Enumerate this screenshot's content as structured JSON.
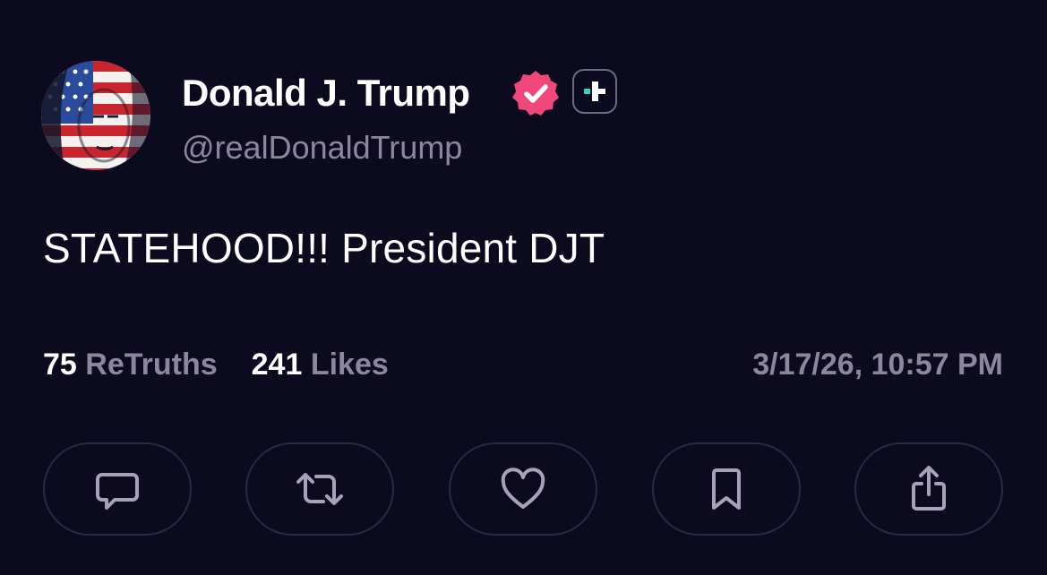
{
  "post": {
    "author": {
      "display_name": "Donald J. Trump",
      "handle": "@realDonaldTrump",
      "avatar_icon": "american-flag-face-avatar",
      "verified_icon": "verified-badge-icon",
      "verified_color": "#f0487b",
      "plus_icon": "truth-plus-icon",
      "plus_accent": "#2fd5c0"
    },
    "text": "STATEHOOD!!! President DJT",
    "stats": {
      "retruths_count": "75",
      "retruths_label": "ReTruths",
      "likes_count": "241",
      "likes_label": "Likes"
    },
    "timestamp": "3/17/26, 10:57 PM"
  },
  "actions": [
    {
      "name": "reply",
      "icon": "comment-icon"
    },
    {
      "name": "retruth",
      "icon": "repost-icon"
    },
    {
      "name": "like",
      "icon": "heart-icon"
    },
    {
      "name": "bookmark",
      "icon": "bookmark-icon"
    },
    {
      "name": "share",
      "icon": "share-icon"
    }
  ],
  "colors": {
    "background": "#0c0a1f",
    "muted_text": "#8a879f",
    "button_border": "#2c2944",
    "icon_color": "#a5a2ba"
  }
}
